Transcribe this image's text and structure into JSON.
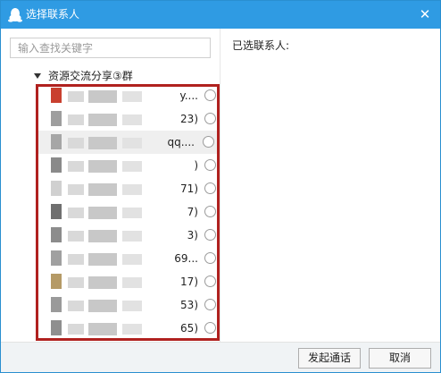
{
  "window": {
    "title": "选择联系人",
    "title_icon": "qq-penguin-icon",
    "close_glyph": "✕"
  },
  "search": {
    "value": "",
    "placeholder": "输入查找关键字"
  },
  "group": {
    "label": "资源交流分享③群",
    "expanded": true,
    "caret_icon": "caret-down-icon"
  },
  "contacts": [
    {
      "suffix": "y....",
      "selected": false,
      "avatar_color": "#c9402f"
    },
    {
      "suffix": "23)",
      "selected": false,
      "avatar_color": "#9e9e9e"
    },
    {
      "suffix": "qq....",
      "selected": true,
      "avatar_color": "#a6a6a6"
    },
    {
      "suffix": ")",
      "selected": false,
      "avatar_color": "#8a8a8a"
    },
    {
      "suffix": "71)",
      "selected": false,
      "avatar_color": "#d0d0d0"
    },
    {
      "suffix": "7)",
      "selected": false,
      "avatar_color": "#6f6f6f"
    },
    {
      "suffix": "3)",
      "selected": false,
      "avatar_color": "#8c8c8c"
    },
    {
      "suffix": "69...",
      "selected": false,
      "avatar_color": "#a0a0a0"
    },
    {
      "suffix": "17)",
      "selected": false,
      "avatar_color": "#b59a66"
    },
    {
      "suffix": "53)",
      "selected": false,
      "avatar_color": "#9a9a9a"
    },
    {
      "suffix": "65)",
      "selected": false,
      "avatar_color": "#8f8f8f"
    }
  ],
  "right": {
    "selected_label": "已选联系人:"
  },
  "footer": {
    "call_label": "发起通话",
    "cancel_label": "取消"
  },
  "colors": {
    "titlebar": "#2f9be3",
    "highlight_box": "#b0211f",
    "footer_bg": "#f0f3f5"
  }
}
